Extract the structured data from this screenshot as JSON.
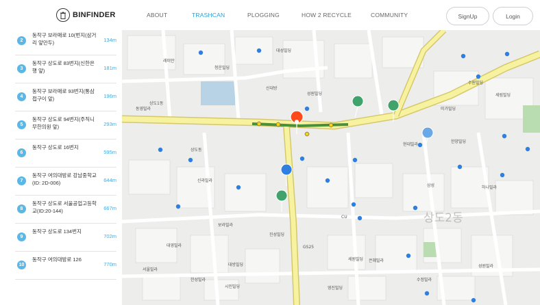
{
  "header": {
    "logo_text": "BINFINDER",
    "nav": [
      {
        "label": "ABOUT",
        "active": false
      },
      {
        "label": "TRASHCAN",
        "active": true
      },
      {
        "label": "PLOGGING",
        "active": false
      },
      {
        "label": "HOW 2 RECYCLE",
        "active": false
      },
      {
        "label": "COMMUNITY",
        "active": false
      }
    ],
    "signup_label": "SignUp",
    "login_label": "Login"
  },
  "list": [
    {
      "num": "2",
      "addr": "동작구 보라매로 10(번지(삼거리 앞만두)",
      "dist": "134m"
    },
    {
      "num": "3",
      "addr": "동작구 상도로 83번지(신한은행 앞)",
      "dist": "181m"
    },
    {
      "num": "4",
      "addr": "동작구 보라매로 93번지(통삼접구이 앞)",
      "dist": "196m"
    },
    {
      "num": "5",
      "addr": "동작구 상도로 94번지(주직니무한의원 앞)",
      "dist": "293m"
    },
    {
      "num": "6",
      "addr": "동작구 상도로 16번지",
      "dist": "595m"
    },
    {
      "num": "7",
      "addr": "동작구 여의대방로 강남중학교 (ID: 2D-006)",
      "dist": "644m"
    },
    {
      "num": "8",
      "addr": "동작구 상도로 서울공업고등학교(ID:20-144)",
      "dist": "667m"
    },
    {
      "num": "9",
      "addr": "동작구 상도로 134번지",
      "dist": "702m"
    },
    {
      "num": "10",
      "addr": "동작구 여의대방로 126",
      "dist": "770m"
    }
  ],
  "map": {
    "labels": [
      "래미안",
      "청운빌딩",
      "대성빌딩",
      "수원빌딩",
      "성원빌딩",
      "신대방",
      "상도1동",
      "미가빌딩",
      "현대빌라",
      "한양빌딩",
      "하나빌라",
      "신라빌라",
      "삼성",
      "세림빌딩",
      "보라빌라",
      "상도동",
      "세원빌딩",
      "진성빌딩",
      "CU",
      "GS25",
      "대방빌딩",
      "은혜빌라",
      "성원빌라",
      "서울빌라",
      "한성빌라",
      "동영빌라",
      "대영빌라",
      "수정빌라",
      "영진빌딩",
      "시민빌딩"
    ],
    "overlay_text": "상도2동",
    "colors": {
      "road_main": "#f6f2a0",
      "road_border": "#d6c86a",
      "route": "#4a8f3a",
      "pin": "#ff4a1a",
      "poi": "#2f7fe0",
      "park": "#b9ddb0"
    }
  }
}
